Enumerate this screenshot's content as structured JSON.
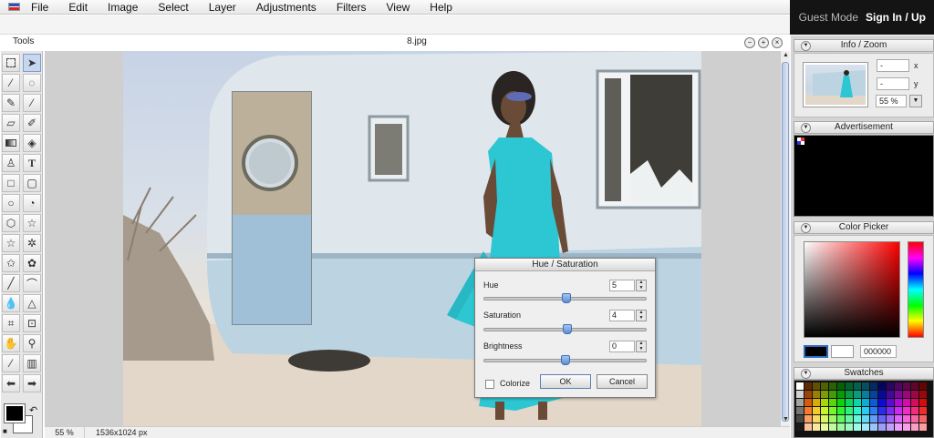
{
  "menu": {
    "items": [
      "File",
      "Edit",
      "Image",
      "Select",
      "Layer",
      "Adjustments",
      "Filters",
      "View",
      "Help"
    ]
  },
  "account": {
    "guest_label": "Guest Mode",
    "signin_label": "Sign In / Up"
  },
  "tools_panel": {
    "title": "Tools"
  },
  "document": {
    "title": "8.jpg",
    "zoom": "55 %",
    "dimensions": "1536x1024 px"
  },
  "info_zoom": {
    "title": "Info / Zoom",
    "x_value": "-",
    "x_label": "x",
    "y_value": "-",
    "y_label": "y",
    "zoom_value": "55 %"
  },
  "advertisement": {
    "title": "Advertisement"
  },
  "color_picker": {
    "title": "Color Picker",
    "hex_value": "000000",
    "foreground": "#000000",
    "background": "#ffffff"
  },
  "swatches": {
    "title": "Swatches"
  },
  "hue_saturation_dialog": {
    "title": "Hue / Saturation",
    "hue_label": "Hue",
    "hue_value": "5",
    "saturation_label": "Saturation",
    "saturation_value": "4",
    "brightness_label": "Brightness",
    "brightness_value": "0",
    "colorize_label": "Colorize",
    "ok_label": "OK",
    "cancel_label": "Cancel"
  }
}
